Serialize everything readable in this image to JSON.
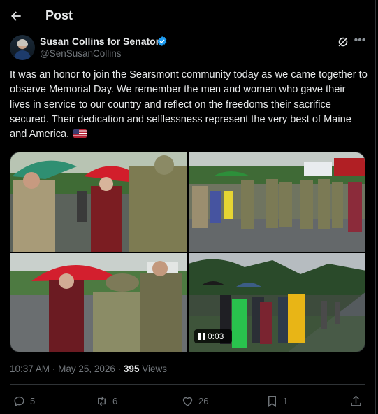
{
  "header": {
    "title": "Post",
    "back_icon": "arrow-left-icon"
  },
  "author": {
    "name": "Susan Collins for Senator",
    "handle": "@SenSusanCollins",
    "verified_color": "#1d9bf0"
  },
  "post": {
    "text": "It was an honor to join the Searsmont community today as we came together to observe Memorial Day. We remember the men and women who gave their lives in service to our country and reflect on the freedoms their sacrifice secured. Their dedication and selflessness represent the very best of Maine and America.",
    "emoji": "us-flag",
    "video_duration": "0:03"
  },
  "meta": {
    "time": "10:37 AM",
    "separator": "·",
    "date": "May 25, 2026",
    "views_count": "395",
    "views_label": "Views"
  },
  "actions": {
    "replies": "5",
    "reposts": "6",
    "likes": "26",
    "bookmarks": "1"
  },
  "colors": {
    "background": "#000000",
    "text": "#e7e9ea",
    "muted": "#71767b",
    "border": "#2f3336",
    "accent": "#1d9bf0"
  }
}
